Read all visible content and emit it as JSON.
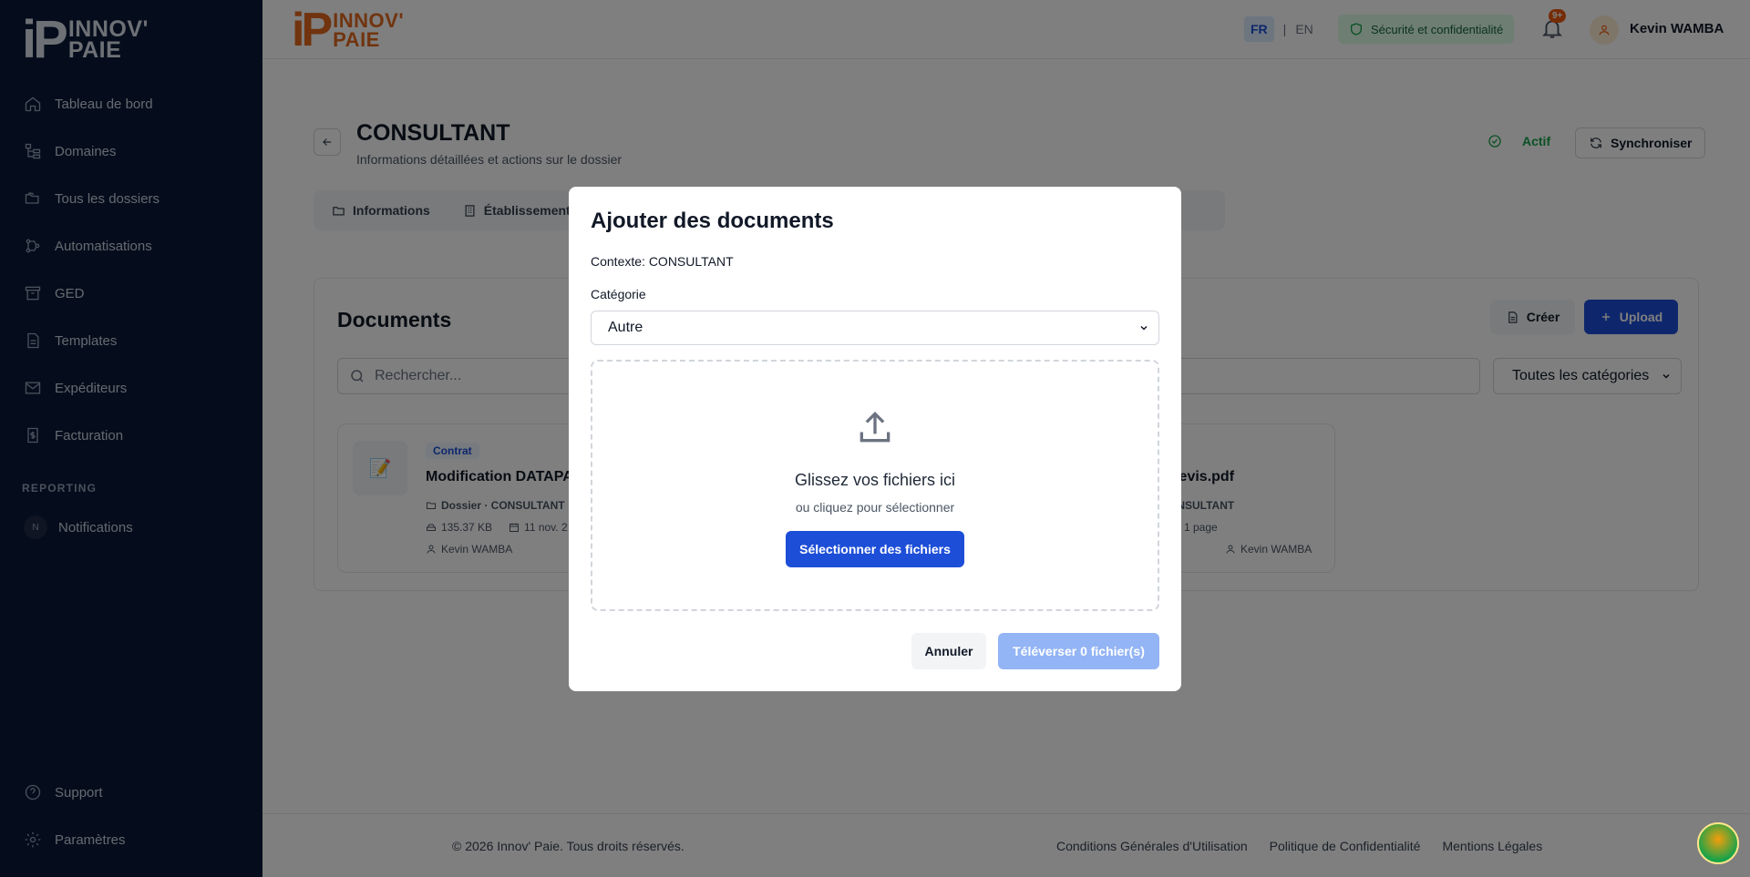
{
  "sidebar": {
    "logo_mark": "iP",
    "logo_line1": "INNOV'",
    "logo_line2": "PAIE",
    "items": [
      {
        "label": "Tableau de bord",
        "icon": "home-icon"
      },
      {
        "label": "Domaines",
        "icon": "hierarchy-icon"
      },
      {
        "label": "Tous les dossiers",
        "icon": "folders-icon"
      },
      {
        "label": "Automatisations",
        "icon": "automation-icon"
      },
      {
        "label": "GED",
        "icon": "archive-icon"
      },
      {
        "label": "Templates",
        "icon": "file-icon"
      },
      {
        "label": "Expéditeurs",
        "icon": "mail-icon"
      },
      {
        "label": "Facturation",
        "icon": "invoice-icon"
      }
    ],
    "section_label": "REPORTING",
    "notifications_badge": "N",
    "notifications_label": "Notifications",
    "bottom_items": [
      {
        "label": "Support",
        "icon": "help-icon"
      },
      {
        "label": "Paramètres",
        "icon": "gear-icon"
      }
    ]
  },
  "topbar": {
    "lang_fr": "FR",
    "lang_sep": "|",
    "lang_en": "EN",
    "security_label": "Sécurité et confidentialité",
    "notif_count": "9+",
    "user_name": "Kevin WAMBA"
  },
  "page": {
    "title": "CONSULTANT",
    "subtitle": "Informations détaillées et actions sur le dossier",
    "status": "Actif",
    "sync_label": "Synchroniser",
    "tabs": [
      {
        "label": "Informations"
      },
      {
        "label": "Établissements"
      }
    ]
  },
  "documents": {
    "title": "Documents",
    "create_label": "Créer",
    "upload_label": "Upload",
    "search_placeholder": "Rechercher...",
    "category_filter": "Toutes les catégories",
    "cards": [
      {
        "tag": "Contrat",
        "name": "Modification DATAPA",
        "folder": "Dossier · CONSULTANT",
        "size": "135.37 KB",
        "date": "11 nov. 2",
        "author": "Kevin WAMBA"
      },
      {
        "name": "Devis.pdf",
        "folder": "ONSULTANT",
        "pages": "1 page",
        "author": "Kevin WAMBA"
      }
    ]
  },
  "modal": {
    "title": "Ajouter des documents",
    "context": "Contexte: CONSULTANT",
    "category_label": "Catégorie",
    "category_value": "Autre",
    "drop_title": "Glissez vos fichiers ici",
    "drop_subtitle": "ou cliquez pour sélectionner",
    "select_files_label": "Sélectionner des fichiers",
    "cancel_label": "Annuler",
    "submit_label": "Téléverser 0 fichier(s)"
  },
  "footer": {
    "copyright": "© 2026 Innov' Paie. Tous droits réservés.",
    "links": [
      "Conditions Générales d'Utilisation",
      "Politique de Confidentialité",
      "Mentions Légales"
    ]
  },
  "colors": {
    "sidebar_bg": "#0b1a38",
    "accent_blue": "#1d4ed8",
    "brand_orange": "#e2691f",
    "active_green": "#16a34a"
  }
}
